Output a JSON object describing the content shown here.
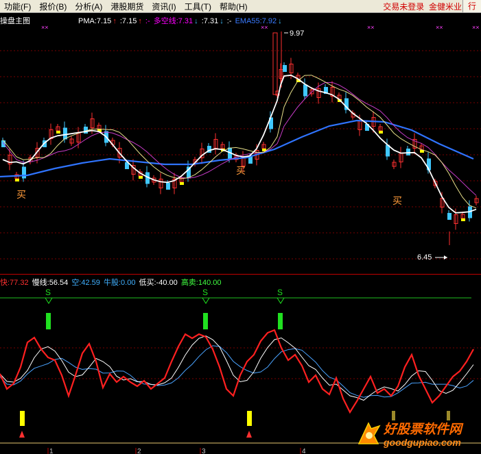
{
  "menu": {
    "items": [
      "功能(F)",
      "报价(B)",
      "分析(A)",
      "港股期货",
      "资讯(I)",
      "工具(T)",
      "帮助(H)"
    ],
    "status": "交易未登录",
    "product": "金健米业",
    "right_button": "行"
  },
  "main_legend": {
    "title": "操盘主图",
    "pma_label": "PMA:7.15",
    "pma_val": ":7.15",
    "dk_label": "多空线:7.31",
    "dk_val": ":7.31",
    "ema_label": "EMA55:7.92",
    "sep": ":-",
    "colors": {
      "pma": "#ffffff",
      "dk": "#ff00ff",
      "ema": "#3a7bff",
      "up": "#ff2a2a",
      "down": "#40c0ff"
    }
  },
  "price_annotations": {
    "high": "9.97",
    "low": "6.45",
    "buy": "买"
  },
  "sub1_legend": {
    "fast": "快:77.32",
    "slow": "慢线:56.54",
    "kong": "空:42.59",
    "niu": "牛股:0.00",
    "dimai": "低买:-40.00",
    "gaomai": "高卖:140.00"
  },
  "sub1_signal": "S",
  "axis_labels": [
    "1",
    "2",
    "3",
    "4"
  ],
  "watermark": {
    "cn": "好股票软件网",
    "en": "goodgupiao.com"
  }
}
